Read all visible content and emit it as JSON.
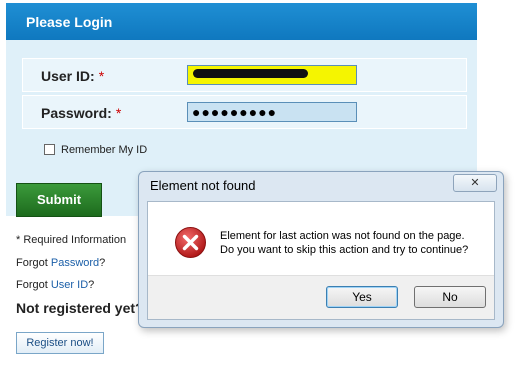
{
  "login": {
    "title": "Please Login",
    "userid_label": "User ID:",
    "password_label": "Password:",
    "required_mark": "*",
    "userid_value": "",
    "password_value": "●●●●●●●●●",
    "remember_label": "Remember My ID",
    "submit_label": "Submit",
    "required_info": "* Required Information",
    "forgot_password_prefix": "Forgot ",
    "forgot_password_link": "Password",
    "forgot_password_suffix": "?",
    "forgot_userid_prefix": "Forgot ",
    "forgot_userid_link": "User ID",
    "forgot_userid_suffix": "?",
    "not_registered": "Not registered yet?",
    "register_label": "Register now!"
  },
  "dialog": {
    "title": "Element not found",
    "close_label": "✕",
    "message_line1": "Element for last action was not found on the page.",
    "message_line2": "Do you want to skip this action and try to continue?",
    "yes_label": "Yes",
    "no_label": "No",
    "icon": "error-icon"
  },
  "colors": {
    "header_blue": "#1583c9",
    "submit_green": "#2a7f2a",
    "highlight_yellow": "#f5f500",
    "error_red": "#d42a2a"
  }
}
